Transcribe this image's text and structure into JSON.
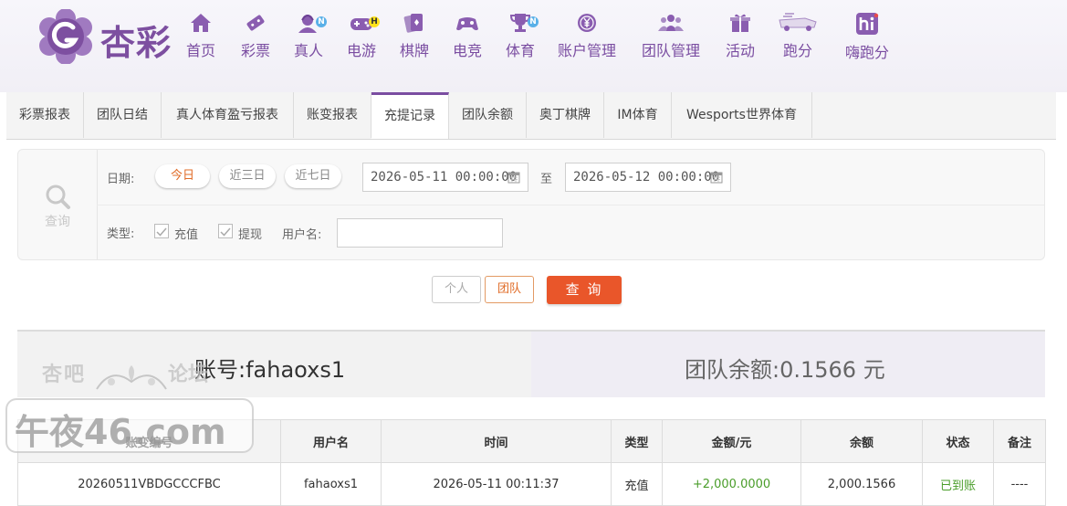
{
  "brand": {
    "name": "杏彩"
  },
  "nav": [
    {
      "label": "首页",
      "icon": "home-icon"
    },
    {
      "label": "彩票",
      "icon": "lottery-ticket-icon"
    },
    {
      "label": "真人",
      "icon": "live-dealer-icon",
      "badge": "N"
    },
    {
      "label": "电游",
      "icon": "gamepad-icon",
      "badge": "H"
    },
    {
      "label": "棋牌",
      "icon": "cards-icon"
    },
    {
      "label": "电竞",
      "icon": "esports-controller-icon"
    },
    {
      "label": "体育",
      "icon": "trophy-icon",
      "badge": "N"
    },
    {
      "label": "账户管理",
      "icon": "account-yen-icon"
    },
    {
      "label": "团队管理",
      "icon": "team-icon"
    },
    {
      "label": "活动",
      "icon": "gift-icon"
    },
    {
      "label": "跑分",
      "icon": "running-score-icon"
    },
    {
      "label": "嗨跑分",
      "icon": "hi-app-icon"
    }
  ],
  "tabs": [
    "彩票报表",
    "团队日结",
    "真人体育盈亏报表",
    "账变报表",
    "充提记录",
    "团队余额",
    "奥丁棋牌",
    "IM体育",
    "Wesports世界体育"
  ],
  "active_tab": "充提记录",
  "filter": {
    "search_label": "查询",
    "date_label": "日期:",
    "quick_ranges": [
      "今日",
      "近三日",
      "近七日"
    ],
    "active_range": "今日",
    "start_date": "2026-05-11 00:00:00",
    "to_label": "至",
    "end_date": "2026-05-12 00:00:00",
    "type_label": "类型:",
    "types": [
      {
        "label": "充值",
        "checked": true
      },
      {
        "label": "提现",
        "checked": true
      }
    ],
    "username_label": "用户名:",
    "username_value": ""
  },
  "scope_buttons": {
    "personal": "个人",
    "team": "团队",
    "active": "团队"
  },
  "query_button": "查 询",
  "summary": {
    "account_label": "账号:",
    "account": "fahaoxs1",
    "team_balance_label": "团队余额:",
    "team_balance": "0.1566",
    "unit": "元"
  },
  "watermark": {
    "line1": "杏吧",
    "line2": "论坛",
    "main": "午夜46.com"
  },
  "table": {
    "headers": [
      "账变编号",
      "用户名",
      "时间",
      "类型",
      "金额/元",
      "余额",
      "状态",
      "备注"
    ],
    "rows": [
      [
        "20260511VBDGCCCFBC",
        "fahaoxs1",
        "2026-05-11 00:11:37",
        "充值",
        "+2,000.0000",
        "2,000.1566",
        "已到账",
        "----"
      ]
    ]
  },
  "colors": {
    "brand_purple": "#7a4da1",
    "accent_orange": "#e9562a",
    "positive_green": "#4a9d2a"
  }
}
